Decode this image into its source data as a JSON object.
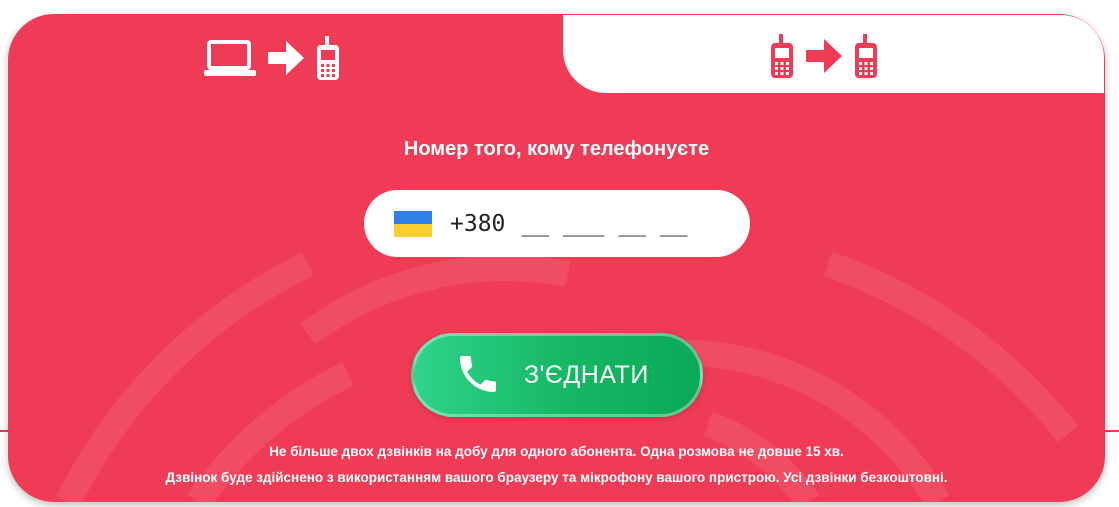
{
  "tabs": [
    {
      "name": "computer-to-phone",
      "icons": [
        "laptop-icon",
        "arrow-right-icon",
        "mobile-phone-icon"
      ],
      "active": true
    },
    {
      "name": "phone-to-phone",
      "icons": [
        "mobile-phone-icon",
        "arrow-right-icon",
        "mobile-phone-icon"
      ],
      "active": false
    }
  ],
  "form": {
    "title": "Номер того, кому телефонуєте",
    "country_flag": "ukraine-flag",
    "prefix": "+380",
    "placeholder": "__ ___ __ __",
    "value": ""
  },
  "connect_button": {
    "label": "З'ЄДНАТИ",
    "icon": "phone-handset-icon"
  },
  "notes": {
    "line1": "Не більше двох дзвінків на добу для одного абонента. Одна розмова не довше 15 хв.",
    "line2": "Дзвінок буде здійснено з використанням вашого браузеру та мікрофону вашого пристрою. Усі дзвінки безкоштовні."
  },
  "colors": {
    "accent": "#ef3b55",
    "button_start": "#2fd38a",
    "button_end": "#0aa957",
    "flag_blue": "#2f7fe8",
    "flag_yellow": "#f7cf2f"
  }
}
